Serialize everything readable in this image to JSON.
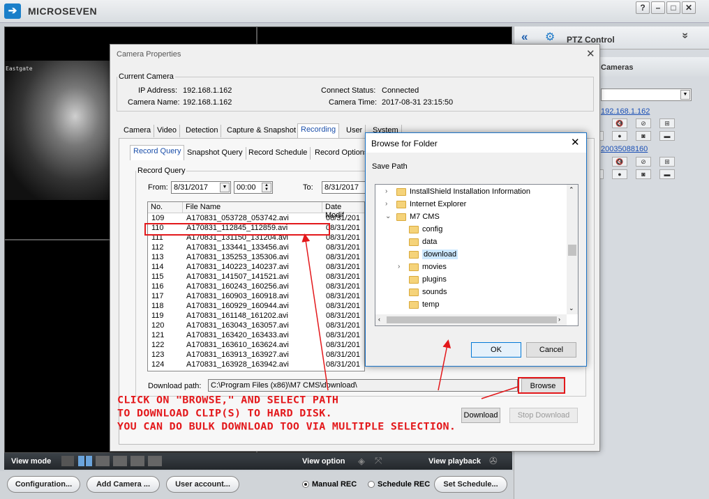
{
  "app": {
    "title": "MICROSEVEN",
    "logo": "arrow-into-box-icon",
    "window_buttons": [
      "?",
      "–",
      "□",
      "✕"
    ]
  },
  "video": {
    "camera_label": "Eastgate"
  },
  "right_panel": {
    "ptz_title": "PTZ Control",
    "cameras_title": "Cameras",
    "camera_ip_1": "192.168.1.162",
    "camera_id_2": "20035088160"
  },
  "bottom_bar": {
    "view_mode": "View mode",
    "view_option": "View option",
    "view_playback": "View playback"
  },
  "bottom_buttons": {
    "configuration": "Configuration...",
    "add_camera": "Add Camera ...",
    "user_account": "User account...",
    "manual_rec": "Manual REC",
    "schedule_rec": "Schedule REC",
    "set_schedule": "Set Schedule...",
    "manual_selected": true
  },
  "dialog": {
    "title": "Camera Properties",
    "current_camera": {
      "legend": "Current Camera",
      "ip_label": "IP Address:",
      "ip": "192.168.1.162",
      "name_label": "Camera Name:",
      "name": "192.168.1.162",
      "status_label": "Connect Status:",
      "status": "Connected",
      "time_label": "Camera Time:",
      "time": "2017-08-31 23:15:50"
    },
    "tabs": [
      "Camera",
      "Video",
      "Detection",
      "Capture & Snapshot",
      "Recording",
      "User",
      "System"
    ],
    "active_tab": "Recording",
    "subtabs": [
      "Record Query",
      "Snapshot Query",
      "Record Schedule",
      "Record Options"
    ],
    "active_subtab": "Record Query",
    "query": {
      "legend": "Record Query",
      "from_label": "From:",
      "from_date": "8/31/2017",
      "from_time": "00:00",
      "to_label": "To:",
      "to_date": "8/31/2017"
    },
    "columns": [
      "No.",
      "File Name",
      "Date Modif"
    ],
    "rows": [
      [
        "109",
        "A170831_053728_053742.avi",
        "08/31/201"
      ],
      [
        "110",
        "A170831_112845_112859.avi",
        "08/31/201"
      ],
      [
        "111",
        "A170831_131150_131204.avi",
        "08/31/201"
      ],
      [
        "112",
        "A170831_133441_133456.avi",
        "08/31/201"
      ],
      [
        "113",
        "A170831_135253_135306.avi",
        "08/31/201"
      ],
      [
        "114",
        "A170831_140223_140237.avi",
        "08/31/201"
      ],
      [
        "115",
        "A170831_141507_141521.avi",
        "08/31/201"
      ],
      [
        "116",
        "A170831_160243_160256.avi",
        "08/31/201"
      ],
      [
        "117",
        "A170831_160903_160918.avi",
        "08/31/201"
      ],
      [
        "118",
        "A170831_160929_160944.avi",
        "08/31/201"
      ],
      [
        "119",
        "A170831_161148_161202.avi",
        "08/31/201"
      ],
      [
        "120",
        "A170831_163043_163057.avi",
        "08/31/201"
      ],
      [
        "121",
        "A170831_163420_163433.avi",
        "08/31/201"
      ],
      [
        "122",
        "A170831_163610_163624.avi",
        "08/31/201"
      ],
      [
        "123",
        "A170831_163913_163927.avi",
        "08/31/201"
      ],
      [
        "124",
        "A170831_163928_163942.avi",
        "08/31/201"
      ]
    ],
    "download_path_label": "Download path:",
    "download_path": "C:\\Program Files (x86)\\M7 CMS\\download\\",
    "browse": "Browse",
    "download": "Download",
    "stop_download": "Stop Download"
  },
  "browse_dialog": {
    "title": "Browse for Folder",
    "subtitle": "Save Path",
    "items": [
      {
        "label": "InstallShield Installation Information",
        "level": 0,
        "expander": "›"
      },
      {
        "label": "Internet Explorer",
        "level": 0,
        "expander": "›"
      },
      {
        "label": "M7 CMS",
        "level": 0,
        "expander": "⌄"
      },
      {
        "label": "config",
        "level": 1,
        "expander": ""
      },
      {
        "label": "data",
        "level": 1,
        "expander": ""
      },
      {
        "label": "download",
        "level": 1,
        "expander": "",
        "selected": true
      },
      {
        "label": "movies",
        "level": 1,
        "expander": "›"
      },
      {
        "label": "plugins",
        "level": 1,
        "expander": ""
      },
      {
        "label": "sounds",
        "level": 1,
        "expander": ""
      },
      {
        "label": "temp",
        "level": 1,
        "expander": ""
      }
    ],
    "ok": "OK",
    "cancel": "Cancel"
  },
  "annotation": {
    "lines": [
      "CLICK ON \"BROWSE,\" AND SELECT PATH",
      "TO DOWNLOAD CLIP(S) TO HARD DISK.",
      "YOU CAN DO BULK DOWNLOAD TOO VIA MULTIPLE SELECTION."
    ],
    "color": "#e3181b"
  }
}
